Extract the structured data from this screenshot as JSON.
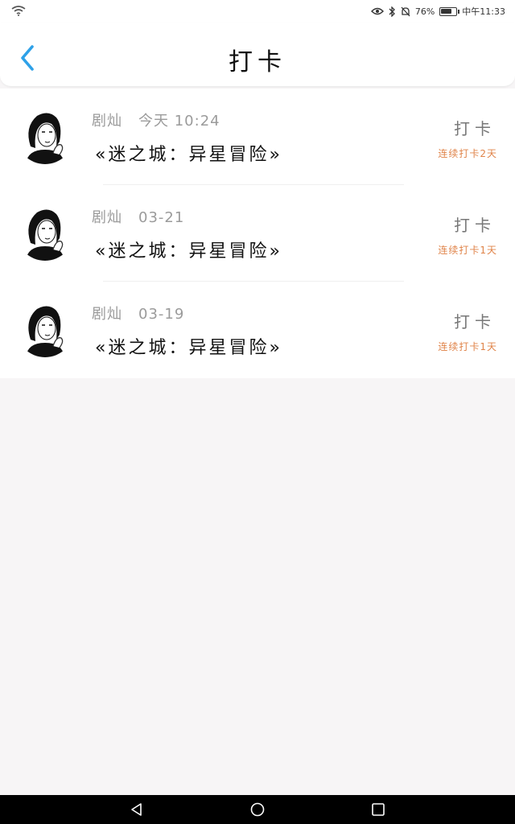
{
  "status_bar": {
    "battery_text": "76%",
    "battery_level": 0.76,
    "time_text": "中午11:33"
  },
  "header": {
    "title": "打卡"
  },
  "entries": [
    {
      "name": "剧灿",
      "time": "今天 10:24",
      "subject": "«迷之城：异星冒险»",
      "button_label": "打卡",
      "streak": "连续打卡2天"
    },
    {
      "name": "剧灿",
      "time": "03-21",
      "subject": "«迷之城：异星冒险»",
      "button_label": "打卡",
      "streak": "连续打卡1天"
    },
    {
      "name": "剧灿",
      "time": "03-19",
      "subject": "«迷之城：异星冒险»",
      "button_label": "打卡",
      "streak": "连续打卡1天"
    }
  ],
  "colors": {
    "accent_blue": "#2ea1e8",
    "streak_orange": "#e0844a",
    "meta_gray": "#9b9b9b"
  },
  "icons": {
    "back": "chevron-left-icon",
    "nav_back": "triangle-back-icon",
    "nav_home": "circle-home-icon",
    "nav_recent": "square-recent-icon"
  }
}
